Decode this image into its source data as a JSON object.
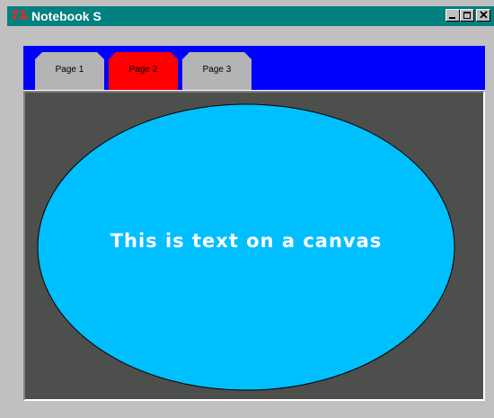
{
  "window": {
    "title": "Notebook S",
    "app_icon": "tk-icon",
    "app_icon_text": "Tk",
    "buttons": {
      "minimize": "minimize-icon",
      "maximize": "maximize-icon",
      "close": "close-icon",
      "close_glyph": "✕"
    }
  },
  "notebook": {
    "tabs": [
      {
        "label": "Page 1",
        "color": "#b4b4b4"
      },
      {
        "label": "Page 2",
        "color": "#ff0000",
        "selected": true
      },
      {
        "label": "Page 3",
        "color": "#b4b4b4"
      }
    ],
    "tabbar_color": "#0000ff"
  },
  "canvas": {
    "background": "#4d4f4d",
    "oval_fill": "#00bfff",
    "text": "This is text on a canvas"
  }
}
